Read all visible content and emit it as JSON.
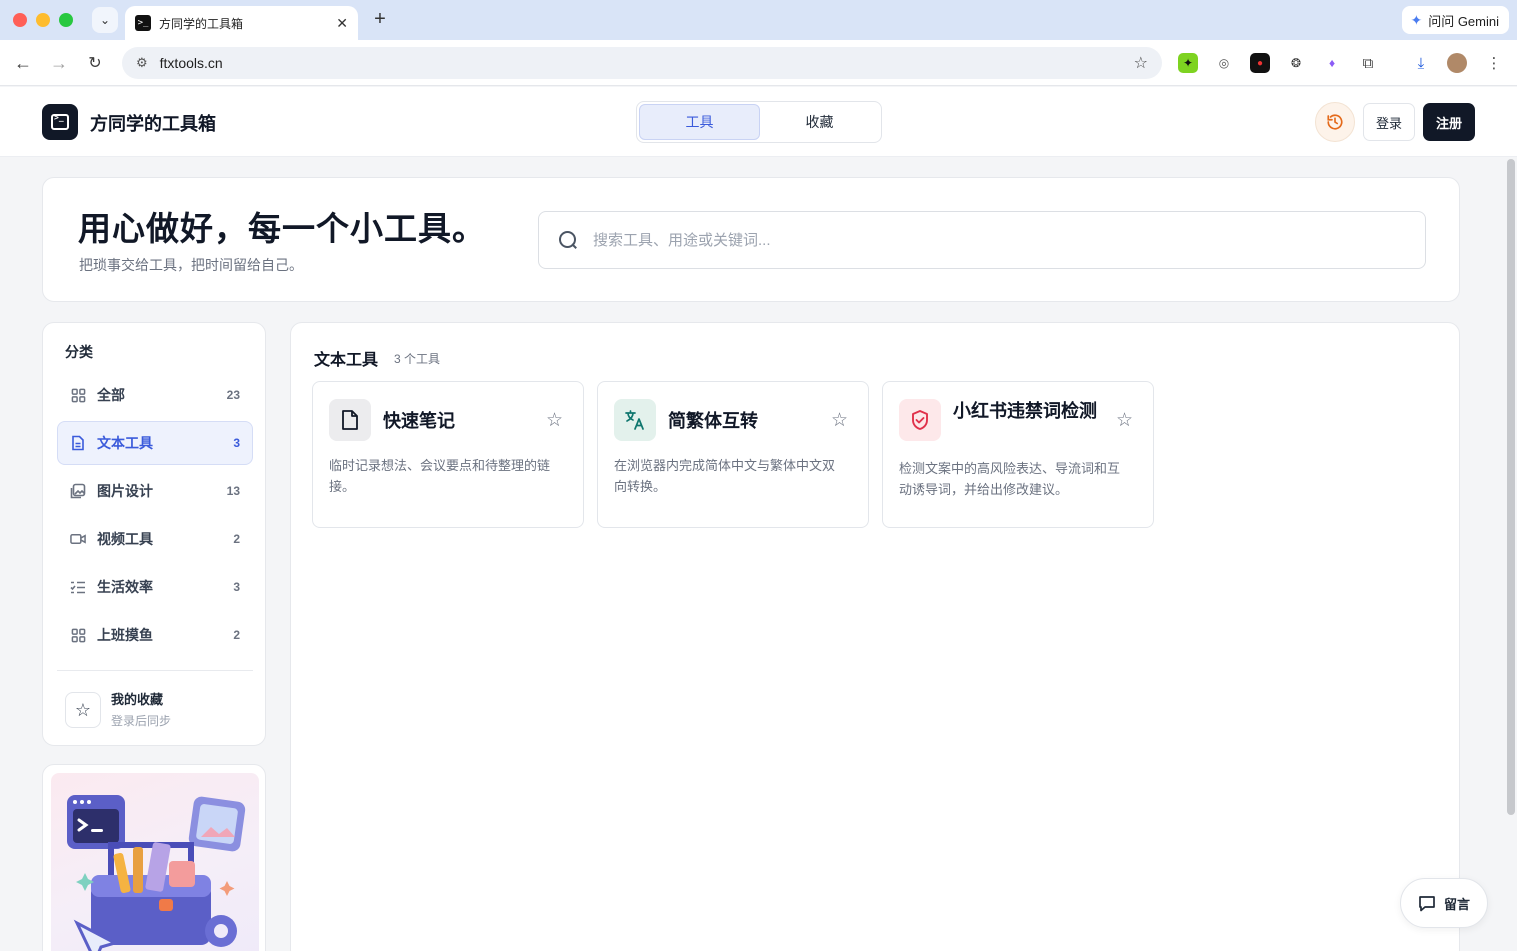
{
  "browser": {
    "tab_title": "方同学的工具箱",
    "url": "ftxtools.cn",
    "gemini_label": "问问 Gemini"
  },
  "header": {
    "site_title": "方同学的工具箱",
    "seg_tools": "工具",
    "seg_favorites": "收藏",
    "login": "登录",
    "signup": "注册"
  },
  "hero": {
    "title": "用心做好，每一个小工具。",
    "subtitle": "把琐事交给工具，把时间留给自己。",
    "search_placeholder": "搜索工具、用途或关键词..."
  },
  "sidebar": {
    "heading": "分类",
    "categories": [
      {
        "label": "全部",
        "count": "23",
        "icon": "grid-icon"
      },
      {
        "label": "文本工具",
        "count": "3",
        "icon": "document-icon"
      },
      {
        "label": "图片设计",
        "count": "13",
        "icon": "image-icon"
      },
      {
        "label": "视频工具",
        "count": "2",
        "icon": "video-icon"
      },
      {
        "label": "生活效率",
        "count": "3",
        "icon": "checklist-icon"
      },
      {
        "label": "上班摸鱼",
        "count": "2",
        "icon": "grid-icon"
      }
    ],
    "favorites_title": "我的收藏",
    "favorites_sub": "登录后同步"
  },
  "main": {
    "section_title": "文本工具",
    "section_count": "3 个工具",
    "cards": [
      {
        "title": "快速笔记",
        "desc": "临时记录想法、会议要点和待整理的链接。",
        "icon": "file-icon"
      },
      {
        "title": "简繁体互转",
        "desc": "在浏览器内完成简体中文与繁体中文双向转换。",
        "icon": "translate-icon"
      },
      {
        "title": "小红书违禁词检测",
        "desc": "检测文案中的高风险表达、导流词和互动诱导词，并给出修改建议。",
        "icon": "shield-check-icon"
      }
    ]
  },
  "feedback": {
    "label": "留言"
  },
  "colors": {
    "accent": "#3b5bdb",
    "dark": "#111827",
    "history": "#e46a1b",
    "shield": "#e0314b"
  }
}
